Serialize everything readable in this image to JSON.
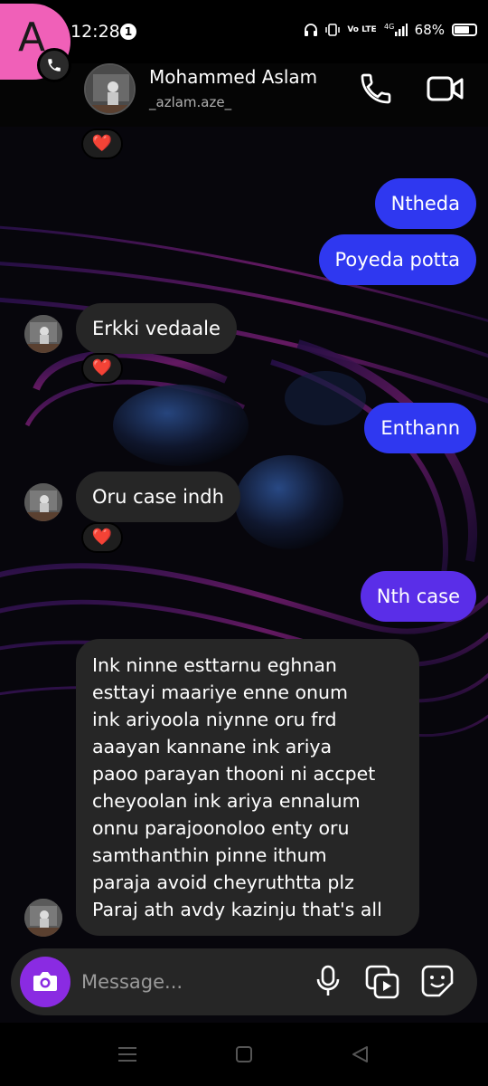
{
  "status_bar": {
    "time": "12:28",
    "notification_count": "1",
    "network_label": "Vo LTE",
    "signal_label": "4G",
    "battery_percent": "68%",
    "battery_level": 0.68
  },
  "header": {
    "profile_letter": "A",
    "contact_name": "Mohammed Aslam",
    "contact_handle": "_azlam.aze_"
  },
  "messages": [
    {
      "direction": "outgoing",
      "text": "Ntheda"
    },
    {
      "direction": "outgoing",
      "text": "Poyeda potta"
    },
    {
      "direction": "incoming",
      "text": "Erkki vedaale",
      "reaction": "❤️"
    },
    {
      "direction": "outgoing",
      "text": "Enthann"
    },
    {
      "direction": "incoming",
      "text": "Oru case indh",
      "reaction": "❤️"
    },
    {
      "direction": "outgoing",
      "text": "Nth case"
    },
    {
      "direction": "incoming",
      "lines": [
        "Ink ninne esttarnu  eghnan",
        "esttayi maariye enne onum",
        "ink ariyoola niynne oru frd",
        "aaayan kannane ink ariya",
        "paoo parayan thooni ni accpet",
        "cheyoolan ink ariya ennalum",
        "onnu parajoonoloo enty oru",
        "samthanthin pinne ithum",
        "paraja avoid cheyruthtta plz",
        "Paraj ath avdy kazinju that's all"
      ]
    }
  ],
  "top_reaction": "❤️",
  "composer": {
    "placeholder": "Message..."
  },
  "colors": {
    "outgoing_bubble": "#2f38f0",
    "outgoing_bubble_alt": "#5a2ee8",
    "incoming_bubble": "#262626",
    "camera_button": "#8a2be2",
    "profile_avatar": "#f060b8"
  }
}
